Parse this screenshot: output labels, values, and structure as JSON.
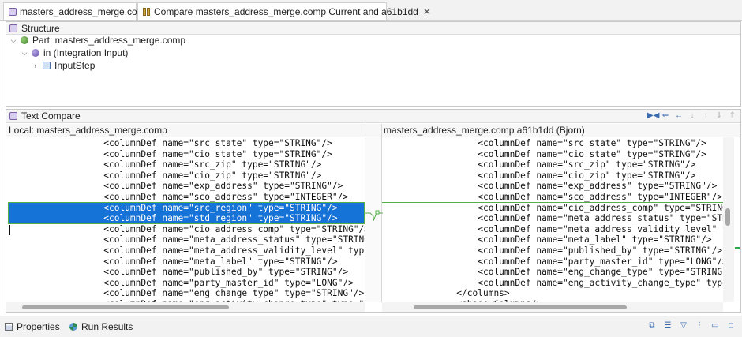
{
  "editor_tabs": [
    {
      "label": "masters_address_merge.comp",
      "icon": "file-icon"
    },
    {
      "label": "Compare masters_address_merge.comp Current and a61b1dd",
      "icon": "compare-icon",
      "close": "✕"
    }
  ],
  "structure": {
    "title": "Structure",
    "tree": [
      {
        "chevron": "⌵",
        "icon": "part-icon",
        "label": "Part: masters_address_merge.comp"
      },
      {
        "chevron": "⌵",
        "icon": "input-icon",
        "label": "in (Integration Input)"
      },
      {
        "chevron": "›",
        "icon": "step-icon",
        "label": "InputStep"
      }
    ]
  },
  "text_compare": {
    "title": "Text Compare",
    "left_title": "Local: masters_address_merge.comp",
    "right_title": "masters_address_merge.comp a61b1dd (Bjorn)",
    "left_lines": [
      "                  <columnDef name=\"src_state\" type=\"STRING\"/>",
      "                  <columnDef name=\"cio_state\" type=\"STRING\"/>",
      "                  <columnDef name=\"src_zip\" type=\"STRING\"/>",
      "                  <columnDef name=\"cio_zip\" type=\"STRING\"/>",
      "                  <columnDef name=\"exp_address\" type=\"STRING\"/>",
      "                  <columnDef name=\"sco_address\" type=\"INTEGER\"/>",
      "                  <columnDef name=\"src_region\" type=\"STRING\"/>",
      "                  <columnDef name=\"std_region\" type=\"STRING\"/>",
      "                  <columnDef name=\"cio_address_comp\" type=\"STRING\"/>",
      "                  <columnDef name=\"meta_address_status\" type=\"STRING\"",
      "                  <columnDef name=\"meta_address_validity_level\" type",
      "                  <columnDef name=\"meta_label\" type=\"STRING\"/>",
      "                  <columnDef name=\"published_by\" type=\"STRING\"/>",
      "                  <columnDef name=\"party_master_id\" type=\"LONG\"/>",
      "                  <columnDef name=\"eng_change_type\" type=\"STRING\"/>",
      "                  <columnDef name=\"eng_activity_change_type\" type=\"S"
    ],
    "right_lines": [
      "                  <columnDef name=\"src_state\" type=\"STRING\"/>",
      "                  <columnDef name=\"cio_state\" type=\"STRING\"/>",
      "                  <columnDef name=\"src_zip\" type=\"STRING\"/>",
      "                  <columnDef name=\"cio_zip\" type=\"STRING\"/>",
      "                  <columnDef name=\"exp_address\" type=\"STRING\"/>",
      "                  <columnDef name=\"sco_address\" type=\"INTEGER\"/>",
      "                  <columnDef name=\"cio_address_comp\" type=\"STRING",
      "                  <columnDef name=\"meta_address_status\" type=\"STR",
      "                  <columnDef name=\"meta_address_validity_level\" t",
      "                  <columnDef name=\"meta_label\" type=\"STRING\"/>",
      "                  <columnDef name=\"published_by\" type=\"STRING\"/>",
      "                  <columnDef name=\"party_master_id\" type=\"LONG\"/>",
      "                  <columnDef name=\"eng_change_type\" type=\"STRING\"",
      "                  <columnDef name=\"eng_activity_change_type\" type",
      "              </columns>",
      "              <shadowColumns/>"
    ],
    "selected_left_lines": [
      6,
      7
    ]
  },
  "bottom_tabs": [
    {
      "label": "Properties",
      "icon": "properties-icon"
    },
    {
      "label": "Run Results",
      "icon": "run-results-icon"
    }
  ],
  "colors": {
    "selection": "#1572d6",
    "change_marker": "#56b04a"
  }
}
